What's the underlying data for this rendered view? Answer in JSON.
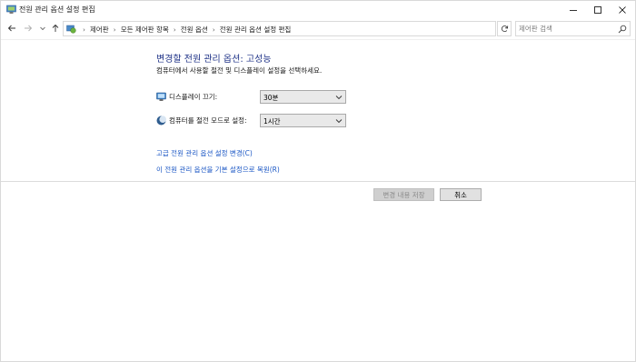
{
  "window": {
    "title": "전원 관리 옵션 설정 편집"
  },
  "address": {
    "breadcrumbs": [
      "제어판",
      "모든 제어판 항목",
      "전원 옵션",
      "전원 관리 옵션 설정 편집"
    ]
  },
  "search": {
    "placeholder": "제어판 검색"
  },
  "content": {
    "heading": "변경할 전원 관리 옵션: 고성능",
    "subheading": "컴퓨터에서 사용할 절전 및 디스플레이 설정을 선택하세요.",
    "display_off_label": "디스플레이 끄기:",
    "display_off_value": "30분",
    "sleep_label": "컴퓨터를 절전 모드로 설정:",
    "sleep_value": "1시간",
    "advanced_link": "고급 전원 관리 옵션 설정 변경(C)",
    "restore_link": "이 전원 관리 옵션을 기본 설정으로 복원(R)"
  },
  "buttons": {
    "save": "변경 내용 저장",
    "cancel": "취소"
  },
  "icons": {
    "app": "power-options-icon",
    "display": "display-icon",
    "sleep": "moon-icon"
  },
  "colors": {
    "heading": "#1e3287",
    "link": "#1a56c4"
  }
}
